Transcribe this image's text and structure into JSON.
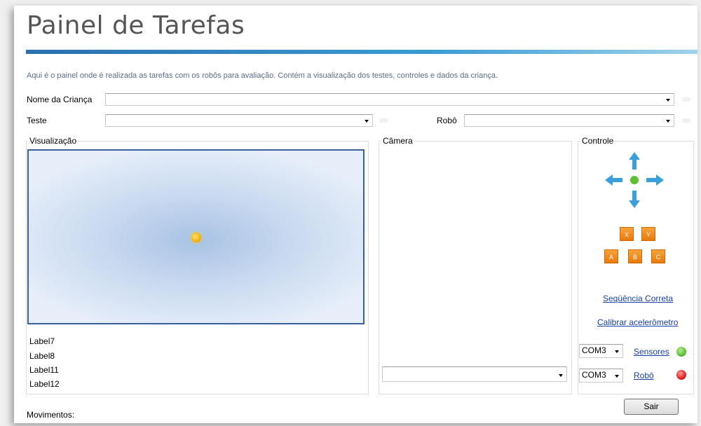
{
  "header": {
    "title": "Painel de Tarefas",
    "description": "Aqui é o painel onde é realizada as tarefas com os robôs para avaliação. Contém a visualização dos testes, controles e dados da criança."
  },
  "form": {
    "child_label": "Nome da Criança",
    "child_value": "",
    "test_label": "Teste",
    "test_value": "",
    "robot_label": "Robô",
    "robot_value": ""
  },
  "visualization": {
    "title": "Visualização",
    "labels": [
      "Label7",
      "Label8",
      "Label11",
      "Label12"
    ]
  },
  "camera": {
    "title": "Câmera",
    "select_value": ""
  },
  "control": {
    "title": "Controle",
    "buttons": [
      "X",
      "Y",
      "A",
      "B",
      "C"
    ],
    "sequence_link": "Seqüência Correta",
    "calibrate_link": "Calibrar acelerômetro",
    "ports": [
      {
        "port": "COM3",
        "link": "Sensores",
        "status_color": "#5cc032"
      },
      {
        "port": "COM3",
        "link": "Robô",
        "status_color": "#e02020"
      }
    ]
  },
  "footer": {
    "movements_label": "Movimentos:",
    "exit_label": "Sair"
  },
  "colors": {
    "accent": "#3a9bd2",
    "arrow": "#3aa0dc",
    "center": "#5cc032",
    "button": "#f08a1c"
  }
}
